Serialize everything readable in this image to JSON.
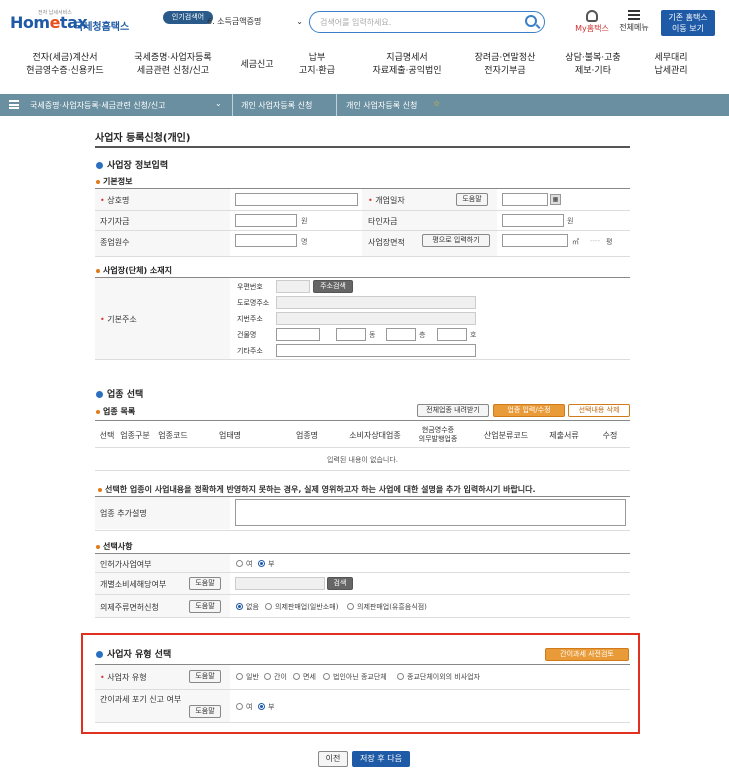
{
  "header": {
    "logo_small": "전자 납세서비스",
    "logo_main_pre": "Hom",
    "logo_main_e": "e",
    "logo_main_post": "tax",
    "logo_sub": "국세청홈택스",
    "hot_badge": "인기검색어",
    "hot_item": "6. 소득금액증명",
    "search_placeholder": "검색어를 입력하세요.",
    "my_hometax": "My홈택스",
    "all_menu": "전체메뉴",
    "old_hometax": "기존 홈택스\n이동 보기"
  },
  "gnb": [
    {
      "label": "전자(세금)계산서\n현금영수증·신용카드"
    },
    {
      "label": "국세증명·사업자등록\n세금관련 신청/신고"
    },
    {
      "label": "세금신고"
    },
    {
      "label": "납부\n고지·환급"
    },
    {
      "label": "지급명세서\n자료제출·공익법인"
    },
    {
      "label": "장려금·연말정산\n전자기부금"
    },
    {
      "label": "상담·불복·고충\n제보·기타"
    },
    {
      "label": "세무대리\n납세관리"
    }
  ],
  "breadcrumb": {
    "level1": "국세증명·사업자등록·세금관련 신청/신고",
    "level2": "개인 사업자등록 신청",
    "level3": "개인 사업자등록 신청"
  },
  "page_title": "사업자 등록신청(개인)",
  "sections": {
    "biz_info": "사업장 정보입력",
    "basic_info": "기본정보",
    "location": "사업장(단체) 소재지",
    "industry": "업종 선택",
    "industry_list": "업종 목록",
    "optional": "선택사항",
    "biz_type": "사업자 유형 선택"
  },
  "basic": {
    "trade_name": "상호명",
    "open_date": "개업일자",
    "own_capital": "자기자금",
    "other_capital": "타인자금",
    "employees": "종업원수",
    "area": "사업장면적",
    "help_btn": "도움말",
    "area_btn": "평으로 입력하기",
    "unit_won": "원",
    "unit_person": "명",
    "unit_m2": "㎡",
    "unit_pyeong": "평"
  },
  "address": {
    "main_label": "기본주소",
    "postal": "우편번호",
    "search_btn": "주소검색",
    "road": "도로명주소",
    "jibun": "지번주소",
    "building": "건물명",
    "dong": "동",
    "floor": "층",
    "ho": "호",
    "other": "기타주소"
  },
  "industry": {
    "load_btn": "전체업종 내려받기",
    "edit_btn": "업종 입력/수정",
    "delete_btn": "선택내용 삭제",
    "headers": [
      "선택",
      "업종구분",
      "업종코드",
      "업태명",
      "업종명",
      "소비자상대업종",
      "현금영수증\n의무발행업종",
      "산업분류코드",
      "제출서류",
      "수정"
    ],
    "empty": "입력된 내용이 없습니다.",
    "note": "선택한 업종이 사업내용을 정확하게 반영하지 못하는 경우, 실제 영위하고자 하는 사업에 대한 설명을 추가 입력하시기 바랍니다.",
    "extra_label": "업종 추가설명"
  },
  "optional": {
    "license": "인허가사업여부",
    "excise": "개별소비세해당여부",
    "liquor": "의제주류면허신청",
    "yes": "여",
    "no": "부",
    "help_btn": "도움말",
    "check_btn": "검색",
    "liquor_none": "없음",
    "liquor_opt1": "의제판매업(일반소매)",
    "liquor_opt2": "의제판매업(유흥음식점)"
  },
  "biz_type": {
    "precheck_btn": "간이과세 사전검토",
    "type_label": "사업자 유형",
    "types": [
      "일반",
      "간이",
      "면세",
      "법인아닌 종교단체",
      "종교단체이외의 비사업자"
    ],
    "simplified_label": "간이과세 포기 신고 여부",
    "yes": "여",
    "no": "부",
    "help_btn": "도움말"
  },
  "footer": {
    "prev": "이전",
    "save_next": "저장 후 다음"
  }
}
